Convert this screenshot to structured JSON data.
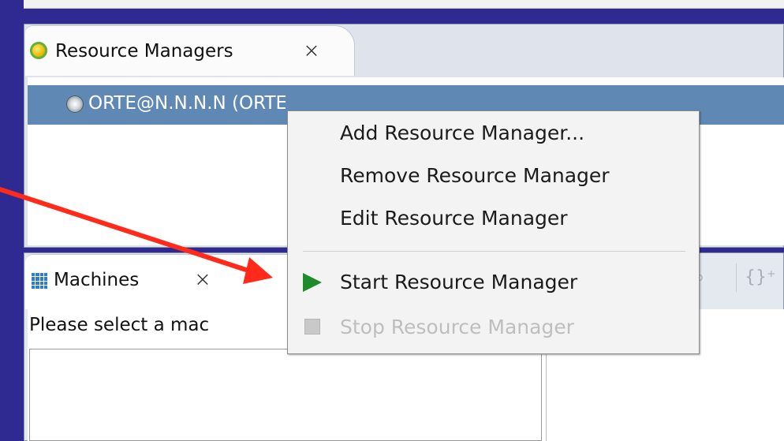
{
  "resource_managers_view": {
    "tab_label": "Resource Managers",
    "close_symbol": "⨉",
    "selected_row_label": "ORTE@N.N.N.N (ORTE)",
    "tab_icon": "resource-manager-icon",
    "row_icon": "resource-manager-node-icon"
  },
  "machines_view": {
    "tab_label": "Machines",
    "close_symbol": "⨉",
    "prompt": "Please select a mac",
    "tab_icon": "grid-icon",
    "toolbar": {
      "search_icon": "magnifier-icon",
      "braces_icon": "braces-icon"
    }
  },
  "context_menu": {
    "items": [
      {
        "label": "Add Resource Manager...",
        "enabled": true
      },
      {
        "label": "Remove Resource Manager",
        "enabled": true
      },
      {
        "label": "Edit Resource Manager",
        "enabled": true
      },
      {
        "label": "Start Resource Manager",
        "enabled": true,
        "icon": "play-icon"
      },
      {
        "label": "Stop Resource Manager",
        "enabled": false,
        "icon": "stop-icon"
      }
    ]
  },
  "colors": {
    "background": "#2f2a92",
    "selection": "#5f89b4",
    "arrow": "#ff2a1a",
    "start_icon": "#1e8c2b"
  }
}
